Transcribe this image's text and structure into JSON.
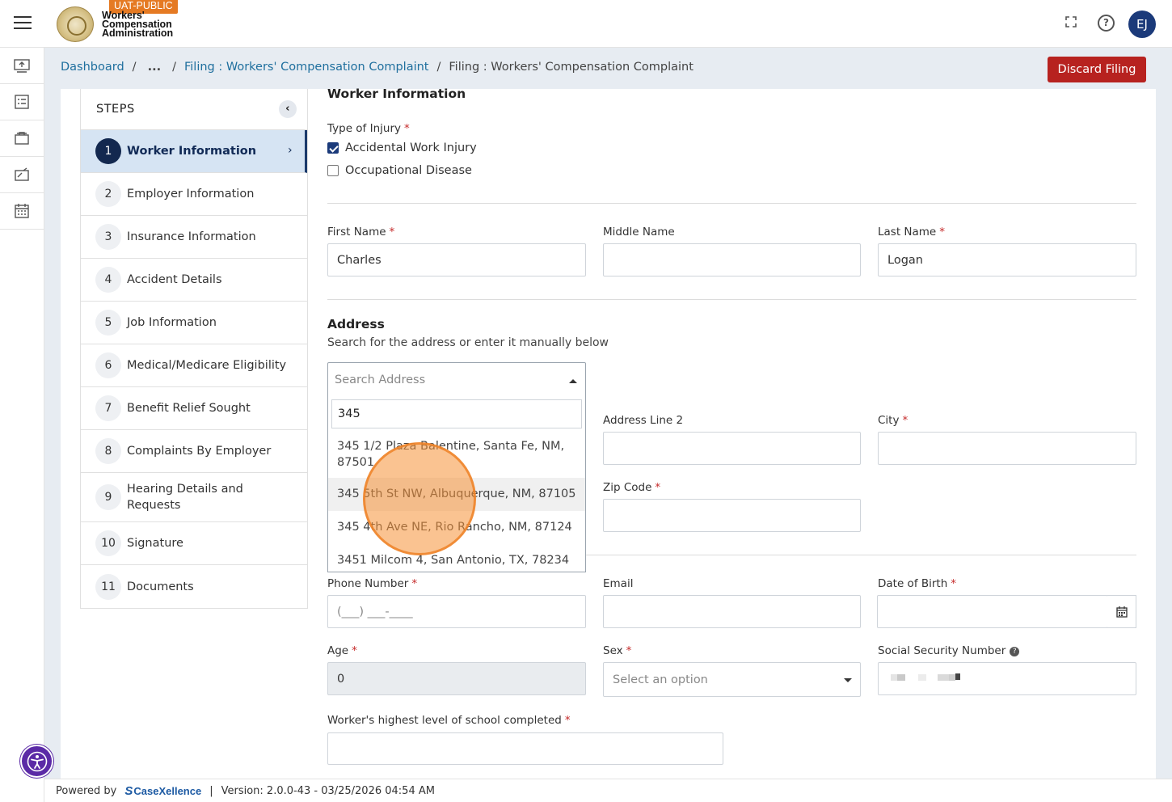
{
  "header": {
    "env_badge": "UAT-PUBLIC",
    "logo_line1": "Workers'",
    "logo_line2": "Compensation",
    "logo_line3": "Administration",
    "avatar_initials": "EJ"
  },
  "breadcrumb": {
    "items": [
      "Dashboard",
      "...",
      "Filing : Workers' Compensation Complaint",
      "Filing : Workers' Compensation Complaint"
    ],
    "separator": "/"
  },
  "discard_label": "Discard Filing",
  "steps": {
    "title": "STEPS",
    "items": [
      {
        "num": "1",
        "label": "Worker Information"
      },
      {
        "num": "2",
        "label": "Employer Information"
      },
      {
        "num": "3",
        "label": "Insurance Information"
      },
      {
        "num": "4",
        "label": "Accident Details"
      },
      {
        "num": "5",
        "label": "Job Information"
      },
      {
        "num": "6",
        "label": "Medical/Medicare Eligibility"
      },
      {
        "num": "7",
        "label": "Benefit Relief Sought"
      },
      {
        "num": "8",
        "label": "Complaints By Employer"
      },
      {
        "num": "9",
        "label": "Hearing Details and Requests"
      },
      {
        "num": "10",
        "label": "Signature"
      },
      {
        "num": "11",
        "label": "Documents"
      }
    ]
  },
  "form": {
    "section_title": "Worker Information",
    "injury_label": "Type of Injury",
    "injury_options": [
      {
        "label": "Accidental Work Injury",
        "checked": true
      },
      {
        "label": "Occupational Disease",
        "checked": false
      }
    ],
    "first_name": {
      "label": "First Name",
      "value": "Charles"
    },
    "middle_name": {
      "label": "Middle Name",
      "value": ""
    },
    "last_name": {
      "label": "Last Name",
      "value": "Logan"
    },
    "address": {
      "title": "Address",
      "subtitle": "Search for the address or enter it manually below",
      "search_placeholder": "Search Address",
      "search_query": "345",
      "suggestions": [
        "345 1/2 Plaza Balentine, Santa Fe, NM, 87501",
        "345 5th St NW, Albuquerque, NM, 87105",
        "345 4th Ave NE, Rio Rancho, NM, 87124",
        "3451 Milcom 4, San Antonio, TX, 78234"
      ]
    },
    "address_line2": {
      "label": "Address Line 2",
      "value": ""
    },
    "city": {
      "label": "City",
      "value": ""
    },
    "zip": {
      "label": "Zip Code",
      "value": ""
    },
    "phone": {
      "label": "Phone Number",
      "placeholder": "(___) ___-____"
    },
    "email": {
      "label": "Email",
      "value": ""
    },
    "dob": {
      "label": "Date of Birth",
      "value": ""
    },
    "age": {
      "label": "Age",
      "value": "0"
    },
    "sex": {
      "label": "Sex",
      "placeholder": "Select an option"
    },
    "ssn": {
      "label": "Social Security Number"
    },
    "school": {
      "label": "Worker's highest level of school completed",
      "value": ""
    }
  },
  "footer": {
    "powered_by": "Powered by",
    "brand": "CaseXellence",
    "divider": "|",
    "version": "Version: 2.0.0-43 - 03/25/2026 04:54 AM"
  }
}
